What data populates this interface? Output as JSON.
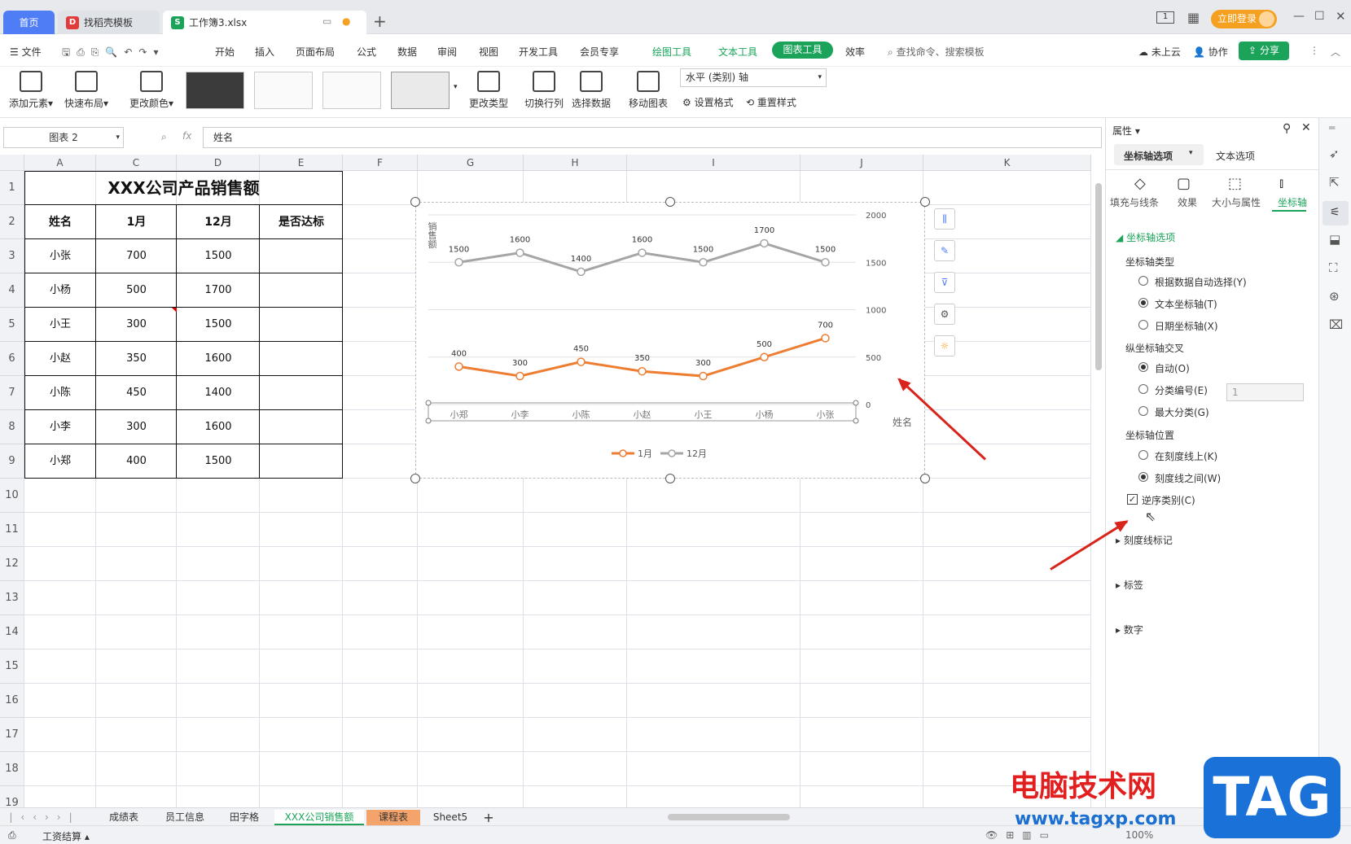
{
  "tabs": {
    "home": "首页",
    "find": "找稻壳模板",
    "book": "工作簿3.xlsx",
    "login": "立即登录"
  },
  "menu": {
    "file": "文件",
    "items": [
      "开始",
      "插入",
      "页面布局",
      "公式",
      "数据",
      "审阅",
      "视图",
      "开发工具",
      "会员专享"
    ],
    "draw_tool": "绘图工具",
    "text_tool": "文本工具",
    "chart_tool": "图表工具",
    "efficiency": "效率",
    "search": "查找命令、搜索模板",
    "cloud": "未上云",
    "collab": "协作",
    "share": "分享"
  },
  "ribbon": {
    "add_element": "添加元素",
    "quick_layout": "快速布局",
    "change_color": "更改颜色",
    "change_type": "更改类型",
    "switch_rowcol": "切换行列",
    "select_data": "选择数据",
    "move_chart": "移动图表",
    "axis_select": "水平 (类别) 轴",
    "set_format": "设置格式",
    "reset_style": "重置样式"
  },
  "formula": {
    "namebox": "图表 2",
    "fx": "fx",
    "content": "姓名"
  },
  "columns": [
    "A",
    "C",
    "D",
    "E",
    "F",
    "G",
    "H",
    "I",
    "J",
    "K"
  ],
  "rows": [
    "1",
    "2",
    "3",
    "4",
    "5",
    "6",
    "7",
    "8",
    "9",
    "10",
    "11",
    "12",
    "13",
    "14",
    "15",
    "16",
    "17",
    "18",
    "19"
  ],
  "table": {
    "title": "XXX公司产品销售额",
    "headers": [
      "姓名",
      "1月",
      "12月",
      "是否达标"
    ],
    "rows": [
      [
        "小张",
        "700",
        "1500",
        ""
      ],
      [
        "小杨",
        "500",
        "1700",
        ""
      ],
      [
        "小王",
        "300",
        "1500",
        ""
      ],
      [
        "小赵",
        "350",
        "1600",
        ""
      ],
      [
        "小陈",
        "450",
        "1400",
        ""
      ],
      [
        "小李",
        "300",
        "1600",
        ""
      ],
      [
        "小郑",
        "400",
        "1500",
        ""
      ]
    ]
  },
  "chart_data": {
    "type": "line",
    "categories": [
      "小郑",
      "小李",
      "小陈",
      "小赵",
      "小王",
      "小杨",
      "小张"
    ],
    "series": [
      {
        "name": "1月",
        "values": [
          400,
          300,
          450,
          350,
          300,
          500,
          700
        ],
        "color": "#ed7d31"
      },
      {
        "name": "12月",
        "values": [
          1500,
          1600,
          1400,
          1600,
          1500,
          1700,
          1500
        ],
        "color": "#a5a5a5"
      }
    ],
    "ylabel": "销售额",
    "xlabel": "姓名",
    "ylim": [
      0,
      2000
    ],
    "yticks": [
      "0",
      "500",
      "1000",
      "1500",
      "2000"
    ],
    "y_axis_side": "right",
    "legend": "bottom",
    "grid": true
  },
  "panel": {
    "title": "属性",
    "tab_axis": "坐标轴选项",
    "tab_text": "文本选项",
    "sub_fill": "填充与线条",
    "sub_effect": "效果",
    "sub_size": "大小与属性",
    "sub_axis": "坐标轴",
    "section": "坐标轴选项",
    "axis_type": "坐标轴类型",
    "opt_auto": "根据数据自动选择(Y)",
    "opt_text": "文本坐标轴(T)",
    "opt_date": "日期坐标轴(X)",
    "cross": "纵坐标轴交叉",
    "cross_auto": "自动(O)",
    "cross_num": "分类编号(E)",
    "cross_num_val": "1",
    "cross_max": "最大分类(G)",
    "pos": "坐标轴位置",
    "pos_on": "在刻度线上(K)",
    "pos_between": "刻度线之间(W)",
    "reverse": "逆序类别(C)",
    "tick_marks": "刻度线标记",
    "labels": "标签",
    "number": "数字"
  },
  "sheets": [
    "成绩表",
    "员工信息",
    "田字格",
    "XXX公司销售额",
    "课程表",
    "Sheet5"
  ],
  "status": {
    "left": "工资结算",
    "zoom": "100%"
  },
  "watermark": {
    "site": "电脑技术网",
    "url": "www.tagxp.com",
    "logo": "TAG"
  }
}
